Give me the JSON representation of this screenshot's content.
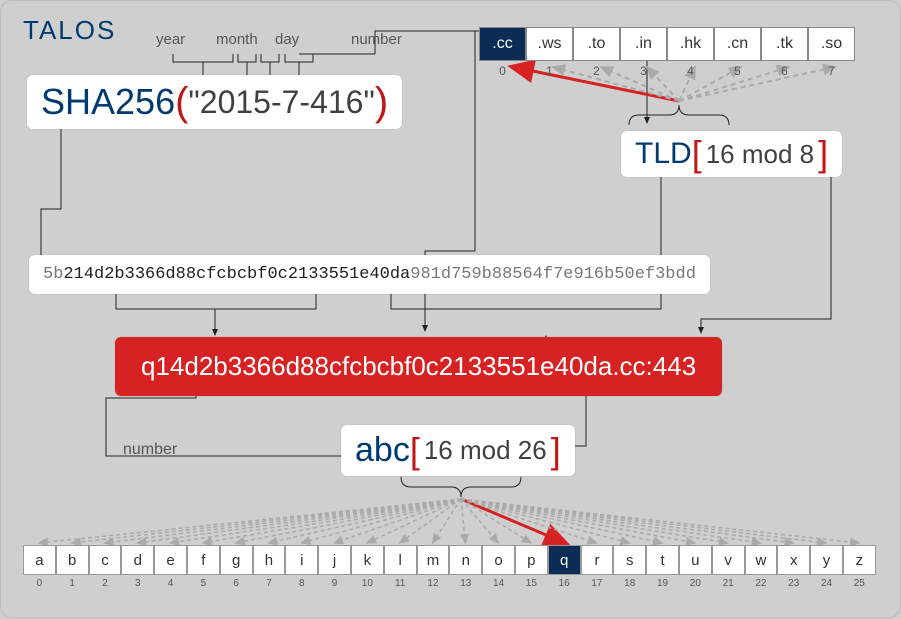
{
  "logo": "TALOS",
  "date_labels": {
    "year": "year",
    "month": "month",
    "day": "day",
    "number": "number"
  },
  "sha256": {
    "label": "SHA256",
    "input": "\"2015-7-416\""
  },
  "hash": {
    "p1": "5b",
    "p2": "214d2b3366d88cfcbcbf0c2133551e40da",
    "p3": "981d759b88564f7e916b50ef3bdd"
  },
  "result": "q14d2b3366d88cfcbcbf0c2133551e40da.cc:443",
  "tld": {
    "label": "TLD",
    "expr": "16 mod 8",
    "items": [
      ".cc",
      ".ws",
      ".to",
      ".in",
      ".hk",
      ".cn",
      ".tk",
      ".so"
    ],
    "selected": 0
  },
  "abc": {
    "label": "abc",
    "expr": "16 mod 26",
    "items": [
      "a",
      "b",
      "c",
      "d",
      "e",
      "f",
      "g",
      "h",
      "i",
      "j",
      "k",
      "l",
      "m",
      "n",
      "o",
      "p",
      "q",
      "r",
      "s",
      "t",
      "u",
      "v",
      "w",
      "x",
      "y",
      "z"
    ],
    "selected": 16
  },
  "number2_label": "number"
}
